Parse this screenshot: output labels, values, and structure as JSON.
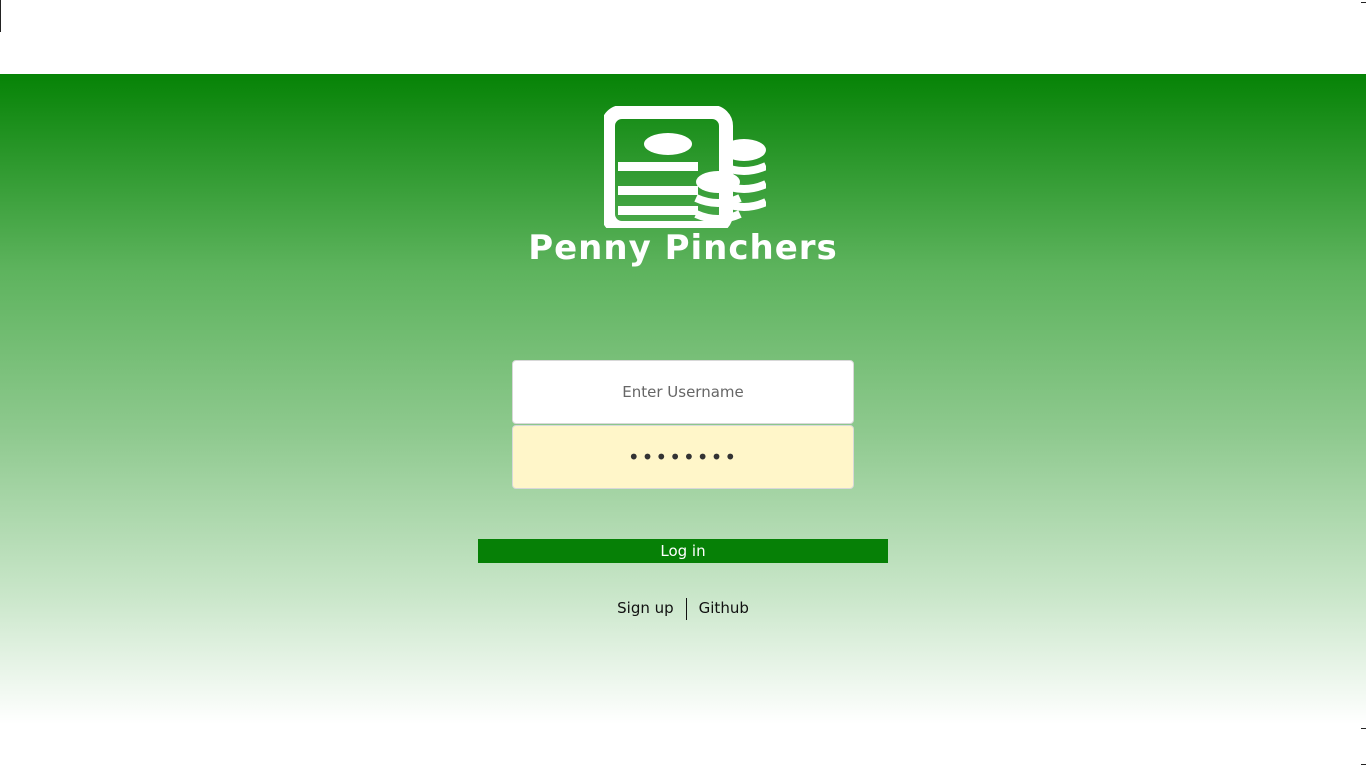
{
  "brand": {
    "name": "Penny Pinchers",
    "logo_icon": "ledger-coins-icon",
    "accent_color": "#068306"
  },
  "login_form": {
    "username_placeholder": "Enter Username",
    "username_value": "",
    "password_value": "••••••••",
    "password_fill_color": "#fff6c9",
    "submit_label": "Log in"
  },
  "footer_links": {
    "signup_label": "Sign up",
    "github_label": "Github"
  }
}
